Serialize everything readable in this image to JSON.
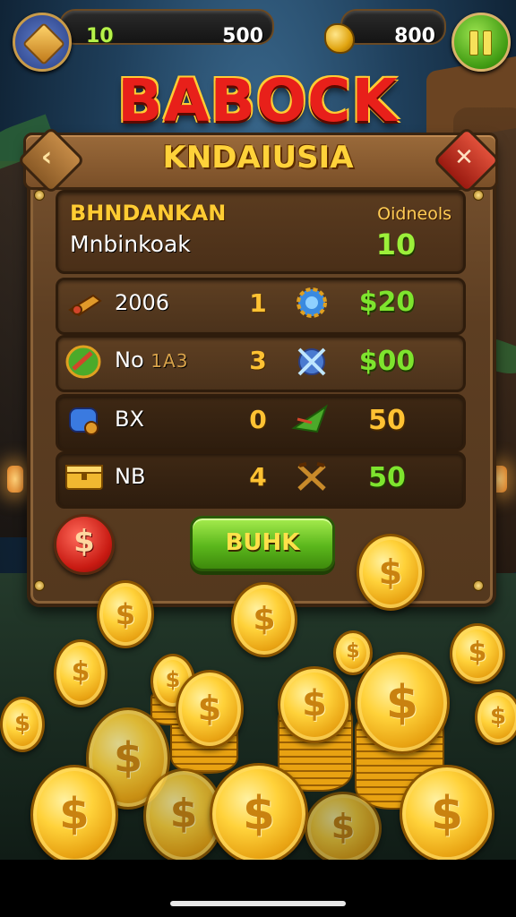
{
  "hud": {
    "gem_value": "10",
    "gem_capacity": "500",
    "gold_value": "800"
  },
  "title": "BABOCK",
  "panel": {
    "title": "KNDAIUSIA",
    "back_glyph": "‹",
    "close_glyph": "✕",
    "info": {
      "title": "BHNDANKAN",
      "subtitle": "Mnbinkoak",
      "right_label": "Oidneols",
      "right_value": "10"
    },
    "rows": [
      {
        "name": "2006",
        "tag": "",
        "qty": "1",
        "price": "$20",
        "price_color": "#7ee42e",
        "icon": "horn-icon",
        "icon2": "gear-icon"
      },
      {
        "name": "No",
        "tag": "1A3",
        "qty": "3",
        "price": "$00",
        "price_color": "#7ee42e",
        "icon": "shield-icon",
        "icon2": "crossed-swords-icon"
      },
      {
        "name": "BX",
        "tag": "",
        "qty": "0",
        "price": "50",
        "price_color": "#ffc233",
        "icon": "cannon-icon",
        "icon2": "leaf-arrow-icon"
      },
      {
        "name": "NB",
        "tag": "",
        "qty": "4",
        "price": "50",
        "price_color": "#7ee42e",
        "icon": "chest-icon",
        "icon2": "crossed-tools-icon"
      }
    ],
    "coin_button_glyph": "$",
    "buy_label": "BUHK"
  },
  "coin_glyph": "$",
  "colors": {
    "title_red": "#e8201a",
    "gold": "#ffd23a",
    "green": "#7ee42e",
    "wood": "#6b4a28"
  }
}
